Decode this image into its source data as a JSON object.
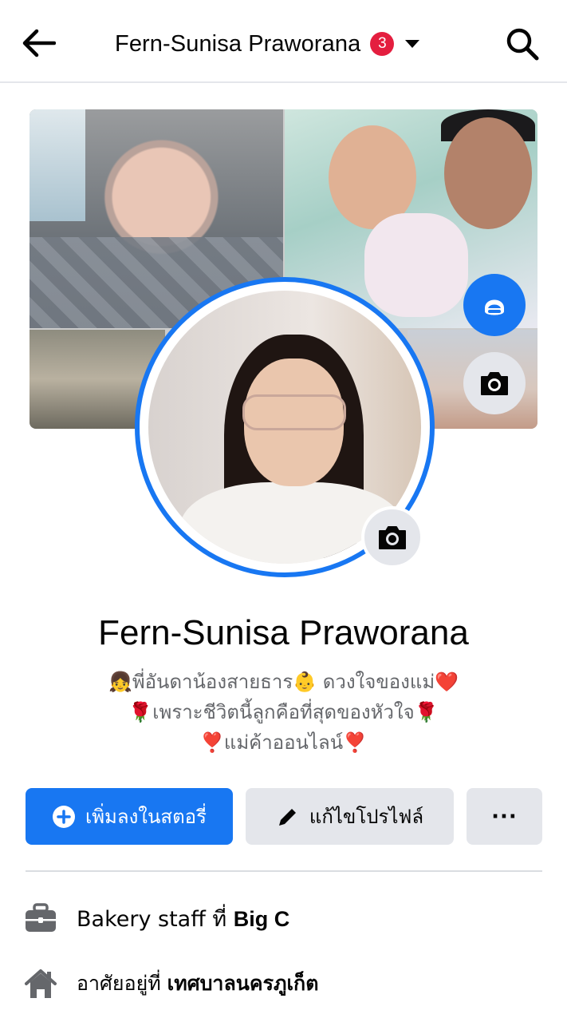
{
  "header": {
    "title": "Fern-Sunisa Praworana",
    "notification_count": "3"
  },
  "profile": {
    "name": "Fern-Sunisa Praworana",
    "bio_lines": [
      "👧พี่อันดาน้องสายธาร👶 ดวงใจของแม่❤️",
      "🌹เพราะชีวิตนี้ลูกคือที่สุดของหัวใจ🌹",
      "❣️แม่ค้าออนไลน์❣️"
    ]
  },
  "actions": {
    "add_story_label": "เพิ่มลงในสตอรี่",
    "edit_profile_label": "แก้ไขโปรไฟล์",
    "more_label": "···"
  },
  "info": {
    "work_label": "Bakery staff ที่ ",
    "work_place": "Big C",
    "home_label": "อาศัยอยู่ที่ ",
    "home_place": "เทศบาลนครภูเก็ต"
  },
  "colors": {
    "accent": "#1877f2",
    "badge": "#e41e3f",
    "button_gray": "#e4e6eb",
    "secondary_text": "#65676b"
  },
  "icons": {
    "back": "back-arrow-icon",
    "search": "search-icon",
    "camera": "camera-icon",
    "avatar": "avatar-icon",
    "plus": "plus-circle-icon",
    "pencil": "pencil-icon",
    "briefcase": "briefcase-icon",
    "home": "home-icon"
  }
}
